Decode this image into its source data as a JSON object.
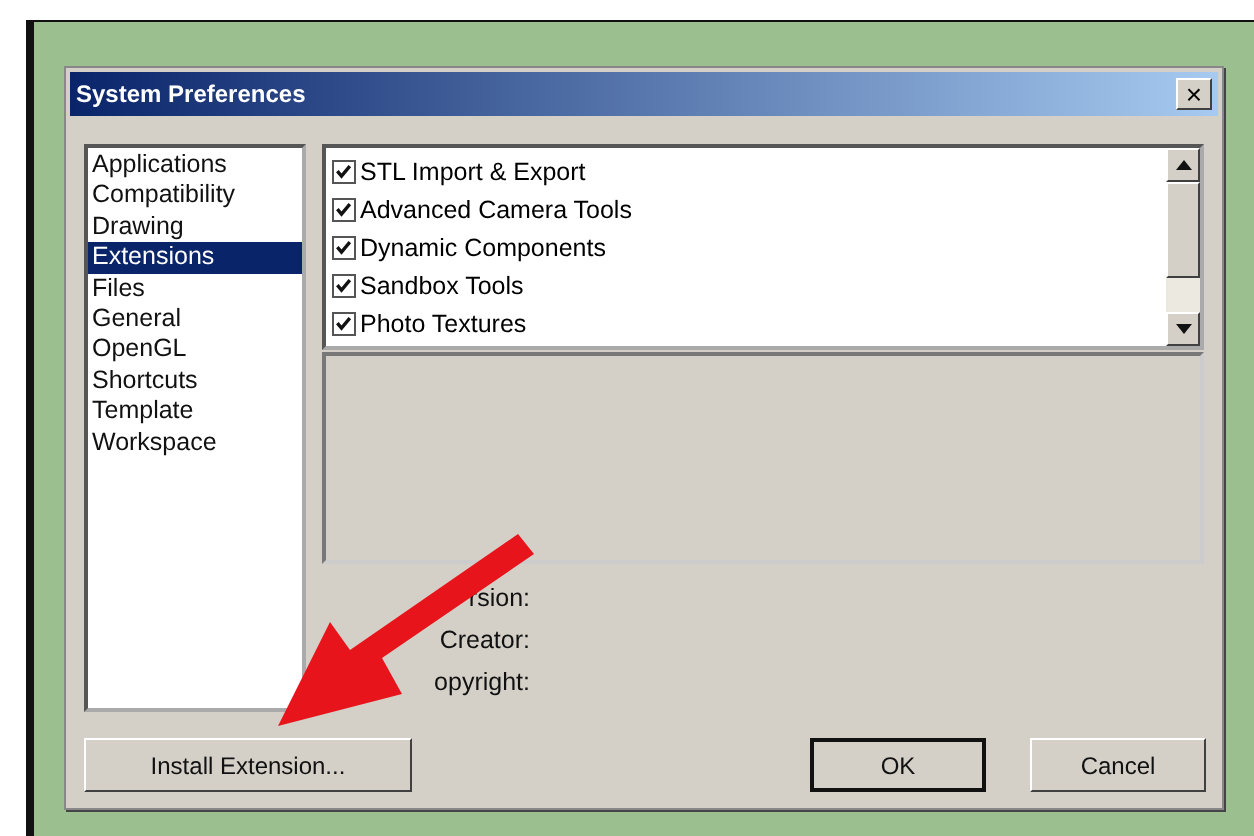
{
  "window": {
    "title": "System Preferences",
    "close": "×"
  },
  "sidebar": {
    "items": [
      {
        "label": "Applications",
        "selected": false
      },
      {
        "label": "Compatibility",
        "selected": false
      },
      {
        "label": "Drawing",
        "selected": false
      },
      {
        "label": "Extensions",
        "selected": true
      },
      {
        "label": "Files",
        "selected": false
      },
      {
        "label": "General",
        "selected": false
      },
      {
        "label": "OpenGL",
        "selected": false
      },
      {
        "label": "Shortcuts",
        "selected": false
      },
      {
        "label": "Template",
        "selected": false
      },
      {
        "label": "Workspace",
        "selected": false
      }
    ]
  },
  "extensions": [
    {
      "label": "STL Import & Export",
      "checked": true
    },
    {
      "label": "Advanced Camera Tools",
      "checked": true
    },
    {
      "label": "Dynamic Components",
      "checked": true
    },
    {
      "label": "Sandbox Tools",
      "checked": true
    },
    {
      "label": "Photo Textures",
      "checked": true
    }
  ],
  "details": [
    "rsion:",
    "Creator:",
    "opyright:"
  ],
  "buttons": {
    "install": "Install Extension...",
    "ok": "OK",
    "cancel": "Cancel"
  }
}
